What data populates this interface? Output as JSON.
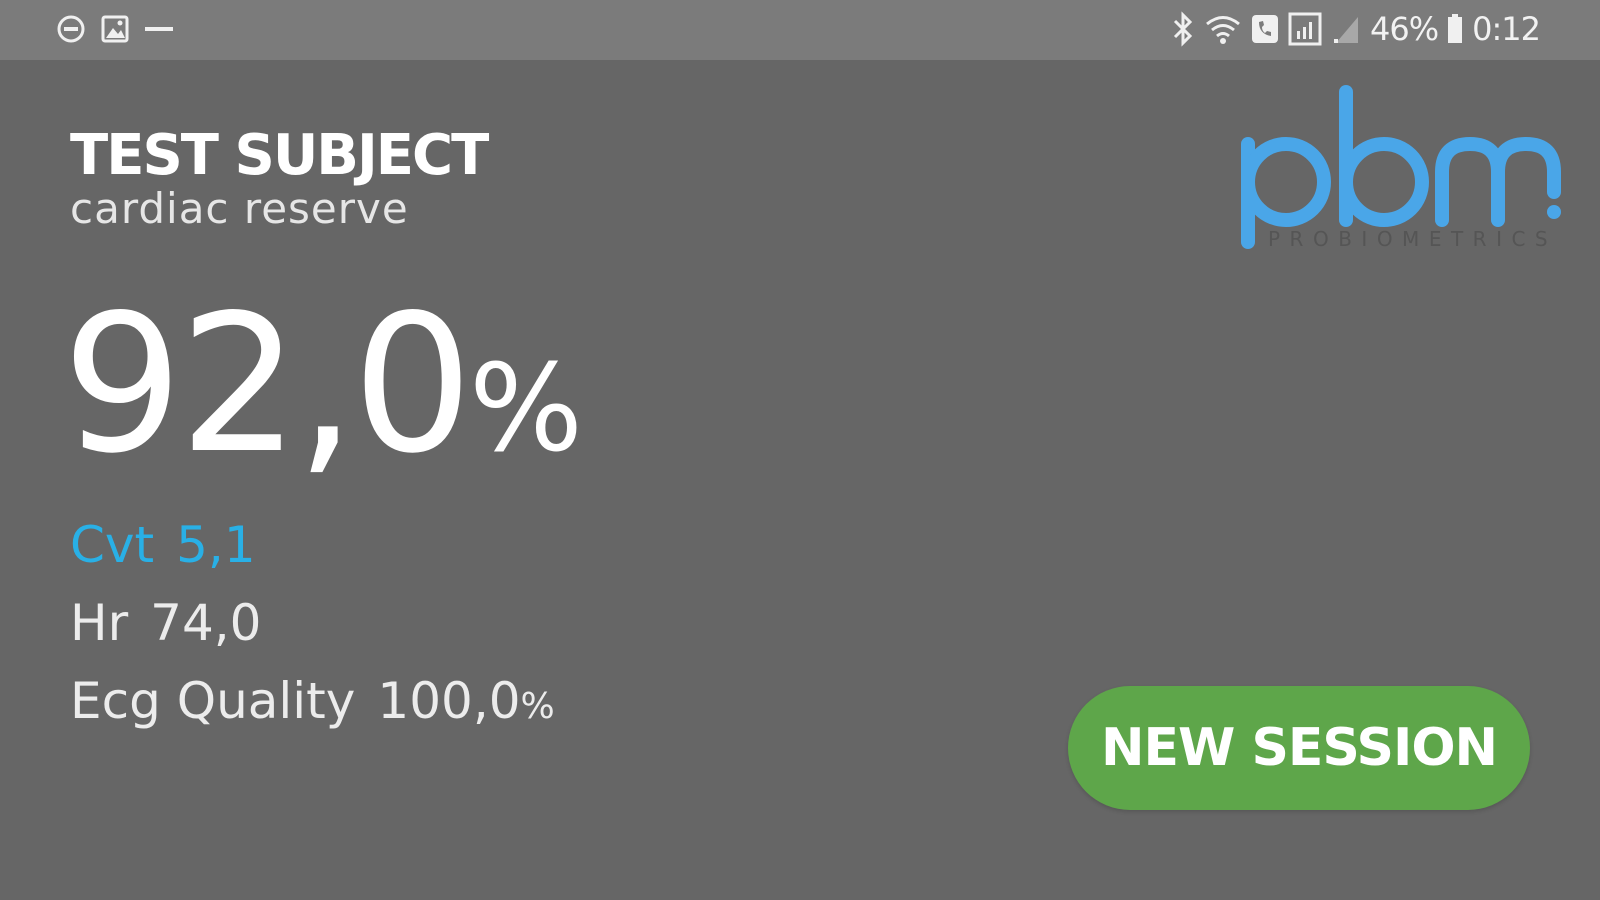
{
  "status_bar": {
    "left_icons": [
      "do-not-disturb-icon",
      "image-icon",
      "minus-icon"
    ],
    "right_icons": [
      "bluetooth-icon",
      "wifi-icon",
      "call-icon",
      "signal-icon",
      "signal-weak-icon",
      "battery-icon"
    ],
    "battery_percent": "46%",
    "time": "0:12"
  },
  "header": {
    "subject": "TEST SUBJECT",
    "subtitle": "cardiac reserve"
  },
  "logo": {
    "wordmark": "pbm",
    "tagline": "PROBIOMETRICS",
    "color": "#4aa6e8"
  },
  "main_value": {
    "number": "92,0",
    "unit": "%"
  },
  "metrics": {
    "cvt": {
      "label": "Cvt",
      "value": "5,1",
      "color": "#29b0e6"
    },
    "hr": {
      "label": "Hr",
      "value": "74,0"
    },
    "ecg": {
      "label": "Ecg Quality",
      "value": "100,0",
      "unit": "%"
    }
  },
  "actions": {
    "new_session_label": "NEW SESSION",
    "new_session_color": "#5ea64a"
  },
  "colors": {
    "background": "#666666",
    "status_bar": "#7b7b7b"
  }
}
